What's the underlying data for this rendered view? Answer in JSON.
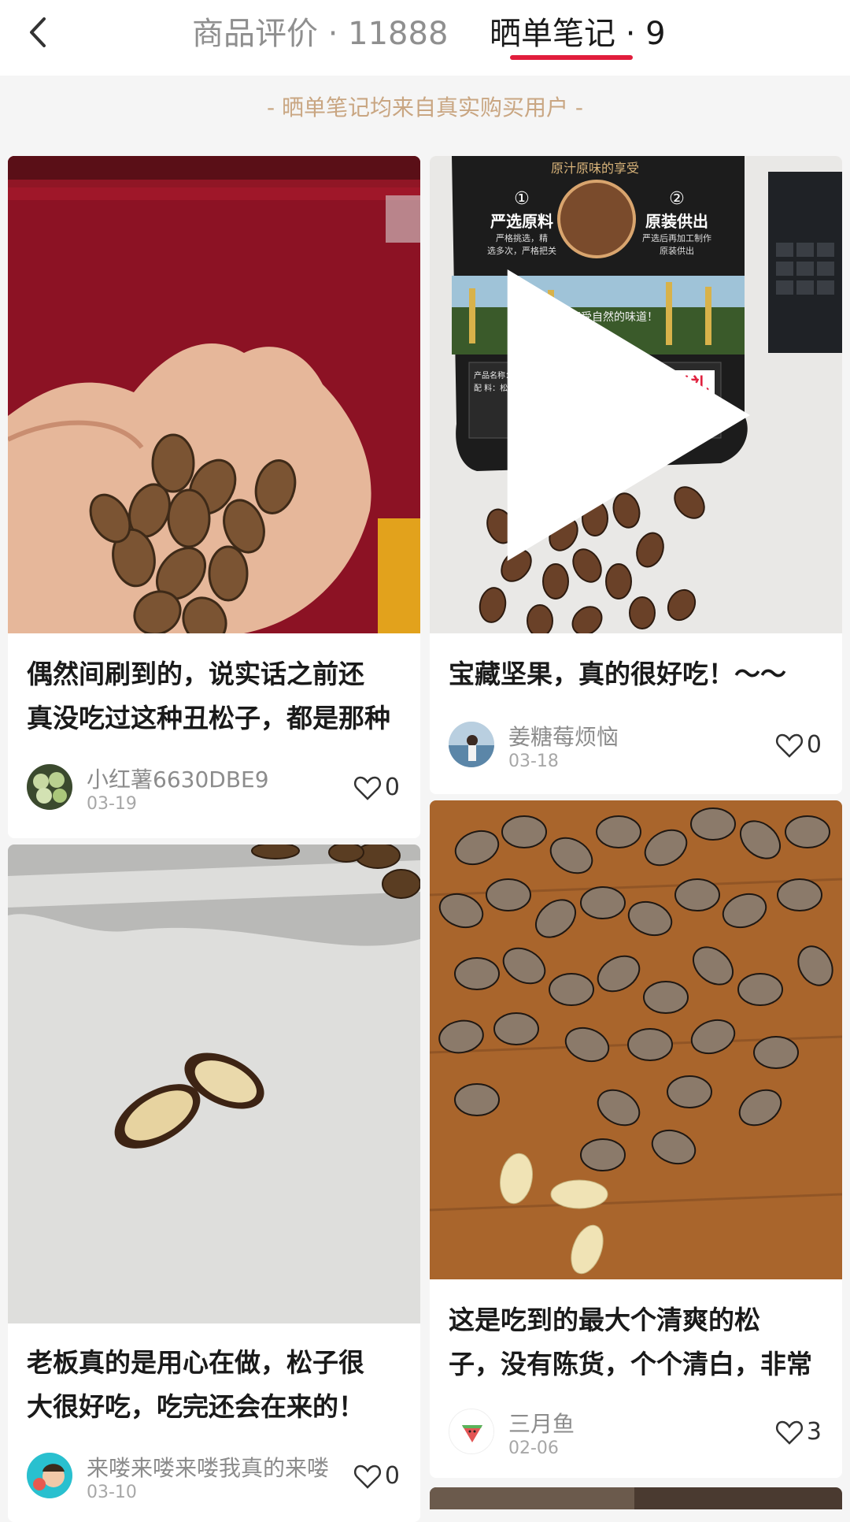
{
  "header": {
    "tab_reviews": "商品评价 · 11888",
    "tab_notes": "晒单笔记 · 9"
  },
  "banner": "- 晒单笔记均来自真实购买用户 -",
  "cards": [
    {
      "text": "偶然间刷到的，说实话之前还\n真没吃过这种丑松子，都是那种",
      "user": "小红薯6630DBE9",
      "date": "03-19",
      "likes": "0"
    },
    {
      "text": "宝藏坚果，真的很好吃！～～",
      "user": "姜糖莓烦恼",
      "date": "03-18",
      "likes": "0",
      "package": {
        "heading": "原汁原味的享受",
        "step1_num": "①",
        "step1_title": "严选原料",
        "step1_desc": "严格挑选，精\n选多次，严格把关",
        "step2_num": "②",
        "step2_title": "原装供出",
        "step2_desc": "严选后再加工制作\n原装供出",
        "slogan": "让你享受自然的味道！",
        "label_line1": "产品名称：松子",
        "label_line2": "配    料：松子",
        "sticker": "送礼\n佳品"
      }
    },
    {
      "text": "老板真的是用心在做，松子很\n大很好吃，吃完还会在来的！",
      "user": "来喽来喽来喽我真的来喽",
      "date": "03-10",
      "likes": "0"
    },
    {
      "text": "这是吃到的最大个清爽的松\n子，没有陈货，个个清白，非常",
      "user": "三月鱼",
      "date": "02-06",
      "likes": "3"
    }
  ],
  "colors": {
    "accent": "#e11d3c",
    "banner_text": "#c9a682",
    "tab_inactive": "#8f8f8f"
  }
}
